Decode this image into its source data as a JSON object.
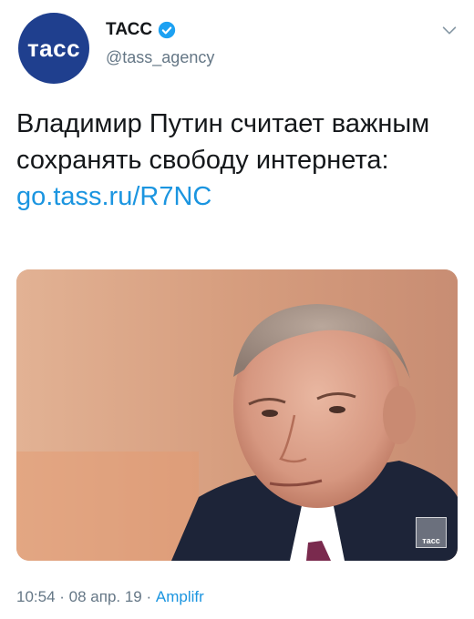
{
  "account": {
    "avatar_text": "тасс",
    "display_name": "ТАСС",
    "handle": "@tass_agency",
    "verified": true
  },
  "tweet": {
    "text": "Владимир Путин считает важным сохранять свободу интернета:",
    "link": "go.tass.ru/R7NC",
    "media_watermark": "тасс"
  },
  "meta": {
    "time": "10:54",
    "separator": " · ",
    "date": "08 апр. 19",
    "source": "Amplifr"
  },
  "colors": {
    "link": "#1b95e0",
    "avatar_bg": "#1f3f8e",
    "verified": "#1da1f2",
    "secondary_text": "#657786"
  },
  "icons": {
    "verified": "verified-badge-icon",
    "caret": "chevron-down-icon"
  }
}
